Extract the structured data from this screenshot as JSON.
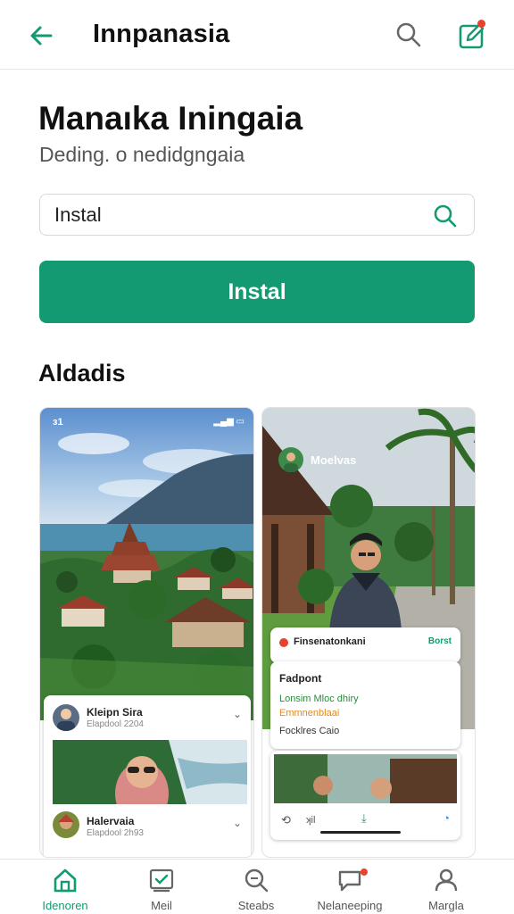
{
  "header": {
    "title": "Innpanasia",
    "back_icon": "arrow-left-icon",
    "search_icon": "search-icon",
    "edit_icon": "edit-square-icon"
  },
  "app": {
    "name": "Manaıka Iningaia",
    "developer": "Deding. o nedidgngaia"
  },
  "search": {
    "value": "Instal"
  },
  "install_button": {
    "label": "Instal"
  },
  "screenshots_section": {
    "title": "Aldadis",
    "left_screenshot": {
      "status_time": "ɜ1",
      "post1": {
        "name": "Kleipn Sira",
        "meta": "Elapdool 2204"
      },
      "post2": {
        "name": "Halervaia",
        "meta": "Elapdool 2h93"
      }
    },
    "right_screenshot": {
      "profile_name": "Moelvas",
      "info_title": "Finsenatonkani",
      "info_action": "Borst",
      "detail_title": "Fadpont",
      "detail_line1": "Lonsim  Mloc  dhiry",
      "detail_line2": "Emmnenblaai",
      "detail_line3": "Focklres Caio",
      "bottom_label": "ʞil"
    }
  },
  "bottom_nav": {
    "items": [
      {
        "label": "Idenoren",
        "icon": "home-icon",
        "active": true
      },
      {
        "label": "Meil",
        "icon": "mail-check-icon",
        "active": false
      },
      {
        "label": "Steabs",
        "icon": "search-doc-icon",
        "active": false
      },
      {
        "label": "Nelaneeping",
        "icon": "chat-icon",
        "active": false,
        "badge": true
      },
      {
        "label": "Margla",
        "icon": "profile-icon",
        "active": false
      }
    ]
  },
  "colors": {
    "accent": "#139a72",
    "badge": "#e8412c"
  }
}
